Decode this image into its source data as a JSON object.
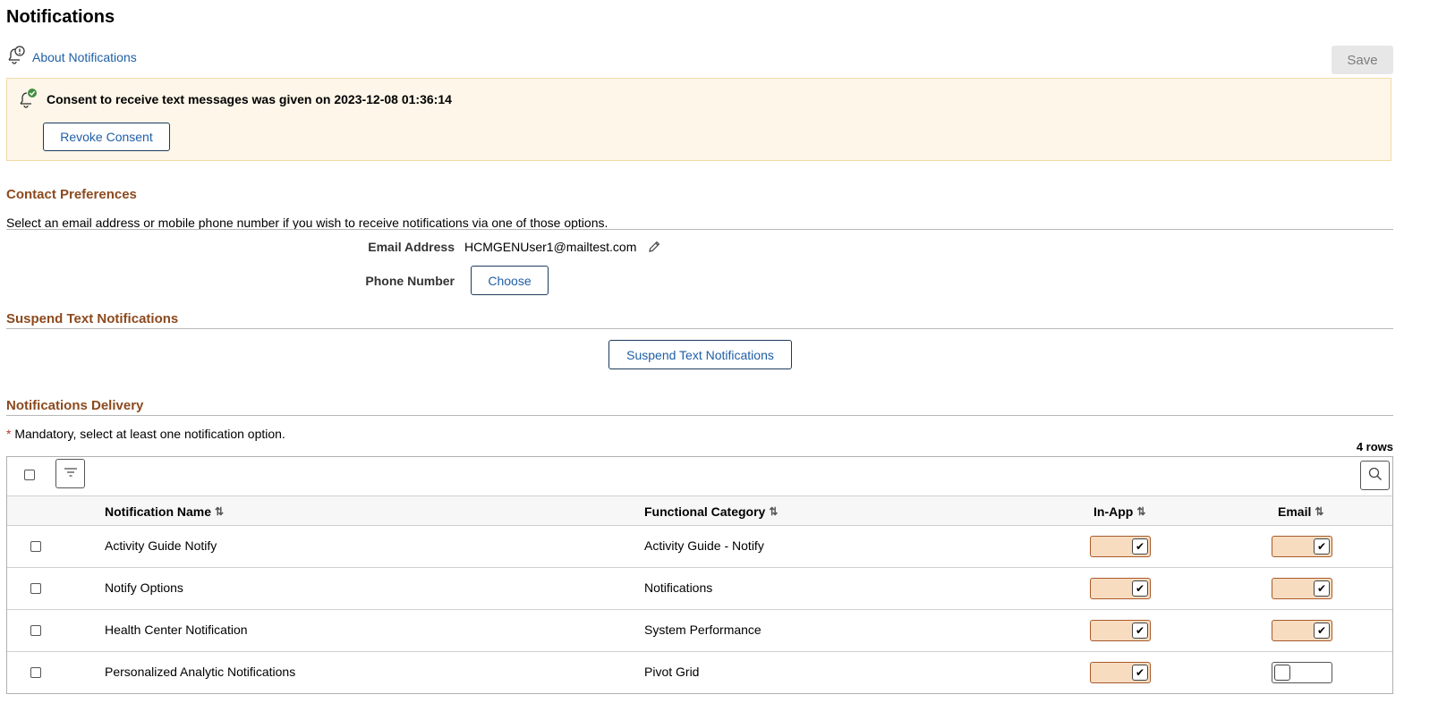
{
  "page": {
    "title": "Notifications",
    "about_link": "About Notifications",
    "save_label": "Save"
  },
  "consent": {
    "message": "Consent to receive text messages was given on 2023-12-08 01:36:14",
    "revoke_label": "Revoke Consent"
  },
  "contact": {
    "heading": "Contact Preferences",
    "description": "Select an email address or mobile phone number if you wish to receive notifications via one of those options.",
    "email_label": "Email Address",
    "email_value": "HCMGENUser1@mailtest.com",
    "phone_label": "Phone Number",
    "choose_label": "Choose"
  },
  "suspend": {
    "heading": "Suspend Text Notifications",
    "button_label": "Suspend Text Notifications"
  },
  "delivery": {
    "heading": "Notifications Delivery",
    "mandatory_star": "*",
    "mandatory_text": " Mandatory, select at least one notification option.",
    "row_count": "4 rows",
    "columns": {
      "name": "Notification Name",
      "category": "Functional Category",
      "inapp": "In-App",
      "email": "Email"
    },
    "sort_glyph": "⇅",
    "rows": [
      {
        "name": "Activity Guide Notify",
        "category": "Activity Guide - Notify",
        "inapp": true,
        "email": true
      },
      {
        "name": "Notify Options",
        "category": "Notifications",
        "inapp": true,
        "email": true
      },
      {
        "name": "Health Center Notification",
        "category": "System Performance",
        "inapp": true,
        "email": true
      },
      {
        "name": "Personalized Analytic Notifications",
        "category": "Pivot Grid",
        "inapp": true,
        "email": false
      }
    ]
  },
  "colors": {
    "link": "#1f5fa6",
    "section_heading": "#8c4a1e",
    "toggle_on": "#f7dcc0",
    "consent_bg": "#fdf6e9"
  },
  "icons": {
    "about": "bell-info-icon",
    "consent": "bell-check-icon",
    "edit": "pencil-icon",
    "filter": "filter-icon",
    "search": "search-icon",
    "sort": "sort-icon",
    "check": "checkmark-icon"
  }
}
